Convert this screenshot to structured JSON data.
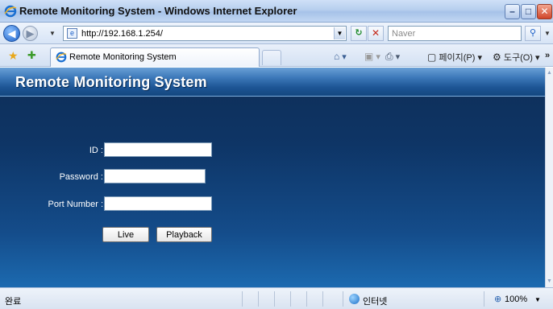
{
  "window": {
    "title": "Remote Monitoring System - Windows Internet Explorer",
    "min_glyph": "–",
    "max_glyph": "□",
    "close_glyph": "✕"
  },
  "address": {
    "url": "http://192.168.1.254/",
    "search_placeholder": "Naver"
  },
  "tab": {
    "label": "Remote Monitoring System"
  },
  "commands": {
    "page_label": "페이지(P)",
    "tools_label": "도구(O)",
    "more": "»"
  },
  "page": {
    "title": "Remote Monitoring System",
    "id_label": "ID :",
    "password_label": "Password :",
    "port_label": "Port Number :",
    "id_value": "",
    "password_value": "",
    "port_value": "",
    "live_button": "Live",
    "playback_button": "Playback"
  },
  "status": {
    "done": "완료",
    "zone": "인터넷",
    "zoom": "100%"
  },
  "icons": [
    "ie-logo-icon",
    "back-icon",
    "forward-icon",
    "page-icon",
    "refresh-icon",
    "stop-icon",
    "search-icon",
    "favorites-icon",
    "add-favorites-icon",
    "home-icon",
    "feed-icon",
    "print-icon",
    "page-menu-icon",
    "tools-icon",
    "internet-zone-icon",
    "zoom-icon"
  ],
  "colors": {
    "header_blue": "#1d5595",
    "content_dark": "#0f2e57",
    "content_light": "#1c6ab0",
    "close_red": "#d0462a"
  }
}
